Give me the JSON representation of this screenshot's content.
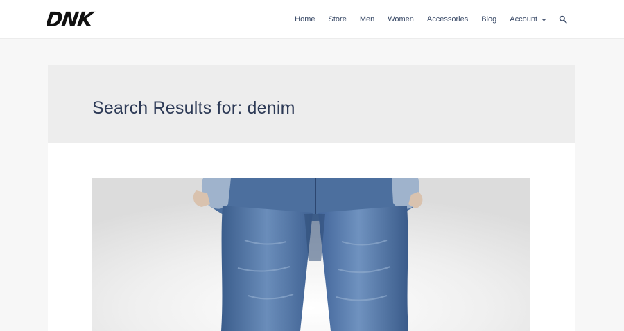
{
  "header": {
    "logo_text": "DNK",
    "nav": [
      {
        "label": "Home"
      },
      {
        "label": "Store"
      },
      {
        "label": "Men"
      },
      {
        "label": "Women"
      },
      {
        "label": "Accessories"
      },
      {
        "label": "Blog"
      },
      {
        "label": "Account"
      }
    ],
    "account_dropdown_icon": "chevron-down-icon",
    "search_icon": "search-icon"
  },
  "page": {
    "title": "Search Results for: denim"
  },
  "colors": {
    "nav_text": "#3a4a67",
    "title_text": "#2d3a56",
    "title_band_bg": "#ededed",
    "page_bg": "#f7f7f7",
    "denim": "#4a6c98"
  },
  "result": {
    "image_subject": "jeans-photo"
  }
}
